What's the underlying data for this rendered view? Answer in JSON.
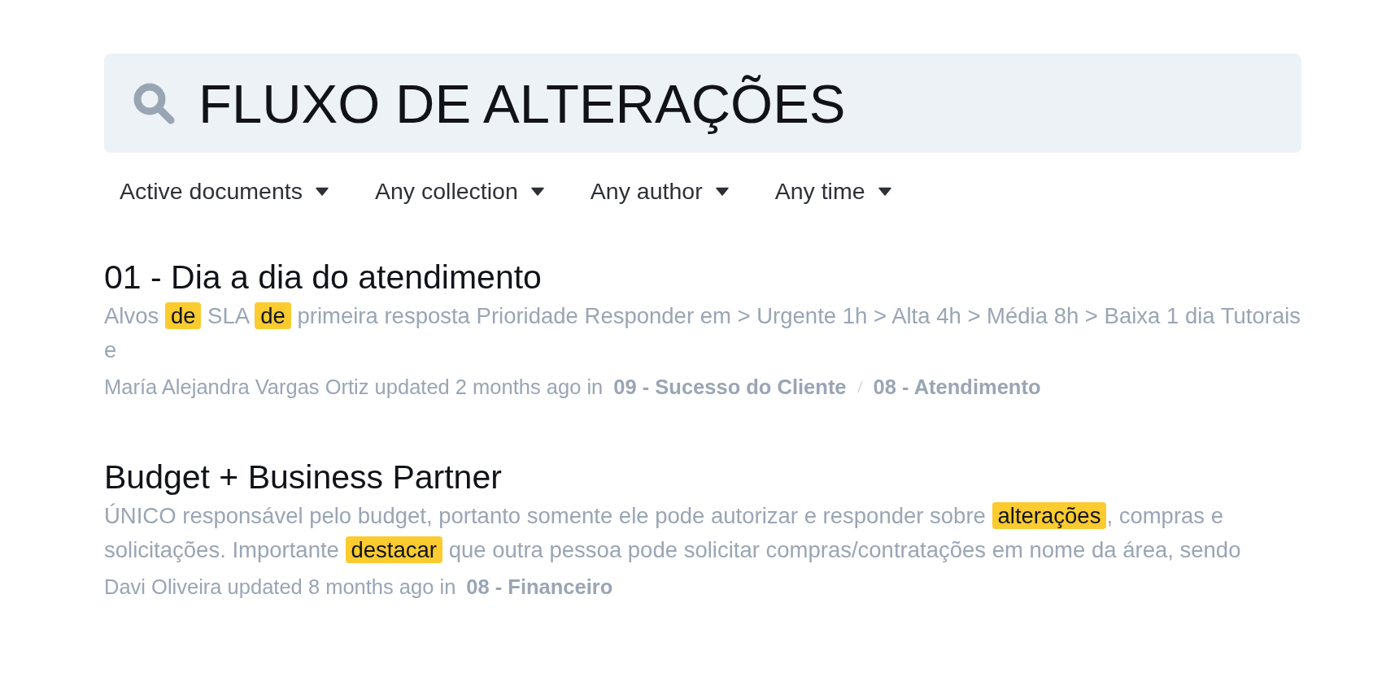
{
  "search": {
    "value": "FLUXO DE ALTERAÇÕES"
  },
  "filters": [
    {
      "label": "Active documents"
    },
    {
      "label": "Any collection"
    },
    {
      "label": "Any author"
    },
    {
      "label": "Any time"
    }
  ],
  "results": [
    {
      "title": "01 - Dia a dia do atendimento",
      "snippet": [
        {
          "text": "Alvos ",
          "highlighted": false
        },
        {
          "text": "de",
          "highlighted": true
        },
        {
          "text": " SLA ",
          "highlighted": false
        },
        {
          "text": "de",
          "highlighted": true
        },
        {
          "text": " primeira resposta Prioridade Responder em > Urgente 1h > Alta 4h > Média 8h > Baixa 1 dia Tutorais e",
          "highlighted": false
        }
      ],
      "updated": "María Alejandra Vargas Ortiz updated 2 months ago in",
      "collections": [
        "09 - Sucesso do Cliente",
        "08 - Atendimento"
      ]
    },
    {
      "title": "Budget + Business Partner",
      "snippet": [
        {
          "text": "ÚNICO responsável pelo budget, portanto somente ele pode autorizar e responder sobre ",
          "highlighted": false
        },
        {
          "text": "alterações",
          "highlighted": true
        },
        {
          "text": ", compras e solicitações. Importante ",
          "highlighted": false
        },
        {
          "text": "destacar",
          "highlighted": true
        },
        {
          "text": " que outra pessoa pode solicitar compras/contratações em nome da área, sendo",
          "highlighted": false
        }
      ],
      "updated": "Davi Oliveira updated 8 months ago in",
      "collections": [
        "08 - Financeiro"
      ]
    }
  ]
}
